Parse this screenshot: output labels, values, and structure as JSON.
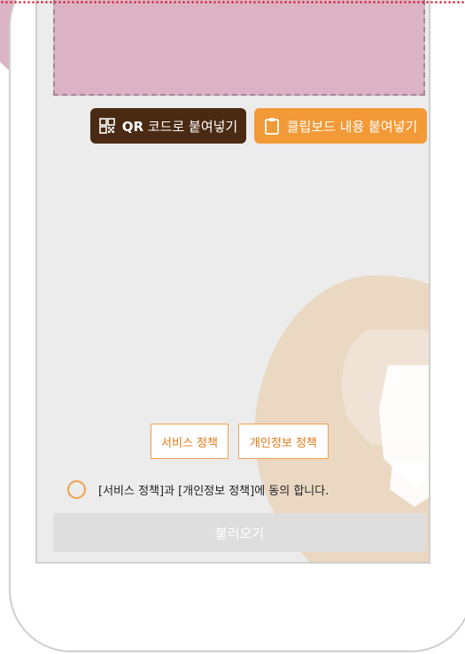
{
  "buttons": {
    "qr_prefix": "QR",
    "qr_label": " 코드로 붙여넣기",
    "clipboard_label": "클립보드 내용 붙여넣기"
  },
  "policies": {
    "service_label": "서비스 정책",
    "privacy_label": "개인정보 정책"
  },
  "agreement": {
    "text": "[서비스 정책]과 [개인정보 정책]에 동의 합니다."
  },
  "load_button": {
    "label": "불러오기"
  },
  "colors": {
    "accent_orange": "#f29a38",
    "dark_brown": "#4a2a12",
    "overlay_pink": "#dbb3c5",
    "dotted_red": "#d9242a"
  },
  "icons": {
    "qr": "qr-code-icon",
    "clipboard": "clipboard-icon",
    "watermark": "lion-logo"
  }
}
